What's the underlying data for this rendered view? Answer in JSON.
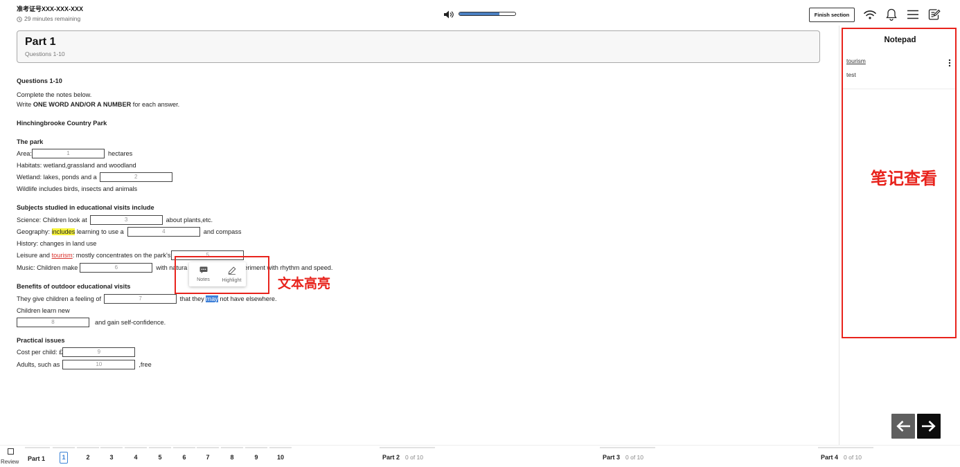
{
  "header": {
    "candidate_id": "准考证号XXX-XXX-XXX",
    "time_remaining": "29 minutes remaining",
    "volume": 0.72,
    "finish_label": "Finish section",
    "icons": {
      "clock": "clock-icon",
      "speaker": "speaker-icon",
      "wifi": "wifi-icon",
      "notifications": "bell-icon",
      "menu": "menu-icon",
      "notepad": "notepad-icon"
    }
  },
  "part": {
    "title": "Part 1",
    "subtitle": "Questions 1-10"
  },
  "instructions": {
    "heading": "Questions 1-10",
    "line1": "Complete the notes below.",
    "limit_pre": "Write ",
    "limit_bold": "ONE WORD AND/OR A NUMBER",
    "limit_post": " for each answer."
  },
  "notes_title": "Hinchingbrooke Country Park",
  "park": {
    "heading": "The park",
    "area_pre": "Area:",
    "area_post": "hectares",
    "habitats": "Habitats: wetland,grassland and woodland",
    "wetland_pre": "Wetland: lakes, ponds and a",
    "wildlife": "Wildlife includes birds, insects and animals"
  },
  "subjects": {
    "heading": "Subjects studied in educational visits include",
    "science_pre": "Science: Children look at",
    "science_post": "about plants,etc.",
    "geo_pre": "Geography: ",
    "geo_highlight": "includes",
    "geo_mid": " learning to use a",
    "geo_post": "and compass",
    "history": "History: changes in land use",
    "leisure_pre": "Leisure and ",
    "leisure_link": "tourism",
    "leisure_post": ": mostly concentrates on the park's",
    "music_pre": "Music: Children make",
    "music_mid": "with natura",
    "music_post": "eriment with rhythm and speed."
  },
  "benefits": {
    "heading": "Benefits of outdoor educational visits",
    "feeling_pre": "They give children a feeling of",
    "feeling_mid": " that they ",
    "feeling_sel": "may",
    "feeling_post": " not have elsewhere.",
    "learn": "Children learn new",
    "learn_post": "and gain self-confidence."
  },
  "practical": {
    "heading": "Practical issues",
    "cost_pre": "Cost per child: £",
    "adults_pre": "Adults, such as",
    "adults_post": ",free"
  },
  "answers": [
    "1",
    "2",
    "3",
    "4",
    "5",
    "6",
    "7",
    "8",
    "9",
    "10"
  ],
  "selection_popup": {
    "notes_label": "Notes",
    "highlight_label": "Highlight",
    "icons": {
      "notes": "comment-icon",
      "highlight": "pencil-icon"
    }
  },
  "annotations": {
    "highlight_caption": "文本高亮",
    "notepad_caption": "笔记查看"
  },
  "notepad": {
    "title": "Notepad",
    "notes": [
      {
        "excerpt": "tourism",
        "text": "test"
      }
    ]
  },
  "navigation": {
    "icons": {
      "prev": "arrow-left-icon",
      "next": "arrow-right-icon"
    }
  },
  "footer": {
    "review_label": "Review",
    "current_question": 1,
    "parts": [
      {
        "label": "Part 1",
        "questions": [
          "1",
          "2",
          "3",
          "4",
          "5",
          "6",
          "7",
          "8",
          "9",
          "10"
        ]
      },
      {
        "label": "Part 2",
        "progress": "0 of 10"
      },
      {
        "label": "Part 3",
        "progress": "0 of 10"
      },
      {
        "label": "Part 4",
        "progress": "0 of 10"
      }
    ]
  },
  "colors": {
    "accent": "#3b82d6",
    "volume": "#4a7fc1",
    "text_highlight": "#f5f23c",
    "selection": "#3d7fd8",
    "link": "#d9312b",
    "annotation": "#e8231c",
    "nav_prev": "#5f5f5f",
    "nav_next": "#0d0d0d"
  }
}
